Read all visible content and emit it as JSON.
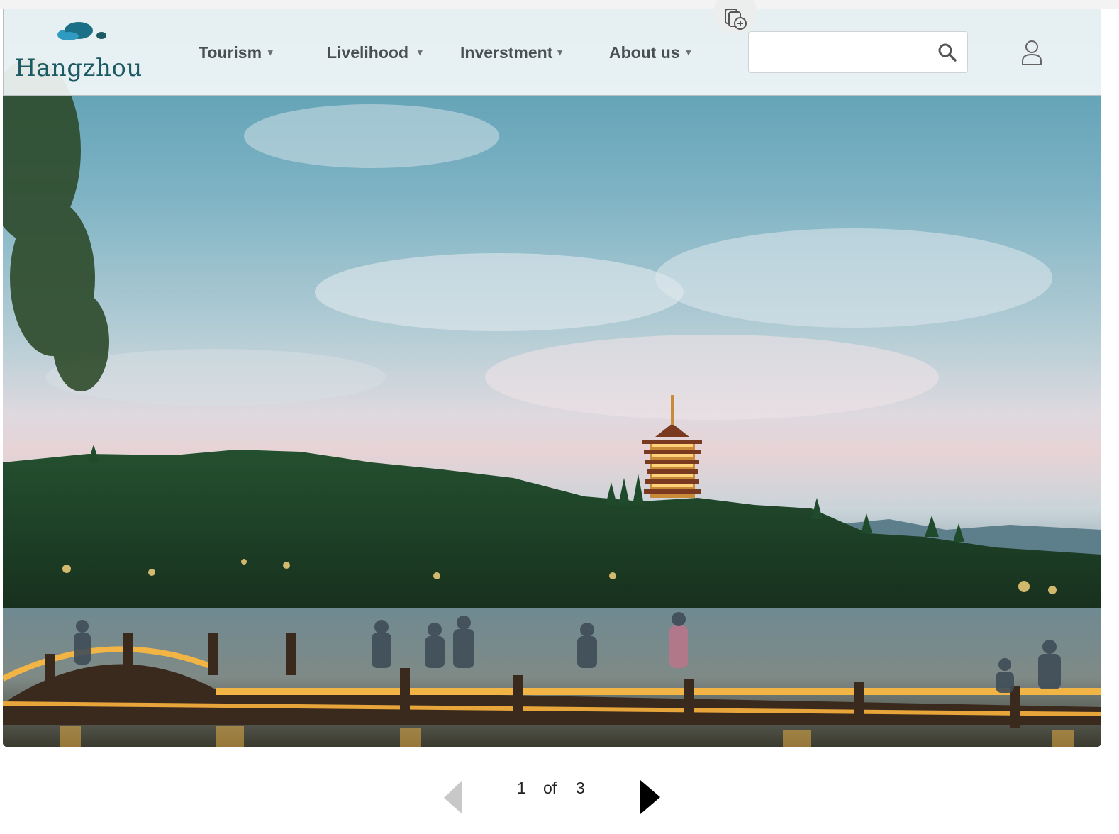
{
  "logo": {
    "text": "Hangzhou"
  },
  "nav": [
    {
      "label": "Tourism",
      "caret": "▾"
    },
    {
      "label": "Livelihood",
      "caret": "▾"
    },
    {
      "label": "Inverstment",
      "caret": "▾"
    },
    {
      "label": "About us",
      "caret": "▾"
    }
  ],
  "search": {
    "value": "",
    "placeholder": "",
    "icon": "search-icon"
  },
  "user": {
    "icon": "user-icon"
  },
  "extension": {
    "icon": "add-to-collection-icon"
  },
  "hero": {
    "image": "West Lake pagoda at dusk"
  },
  "pagination": {
    "current": "1",
    "of_label": "of",
    "total": "3"
  },
  "colors": {
    "brand": "#1b5a63",
    "nav_text": "#4a4f52",
    "prev_disabled": "#c8c8c8",
    "next_active": "#000000"
  }
}
